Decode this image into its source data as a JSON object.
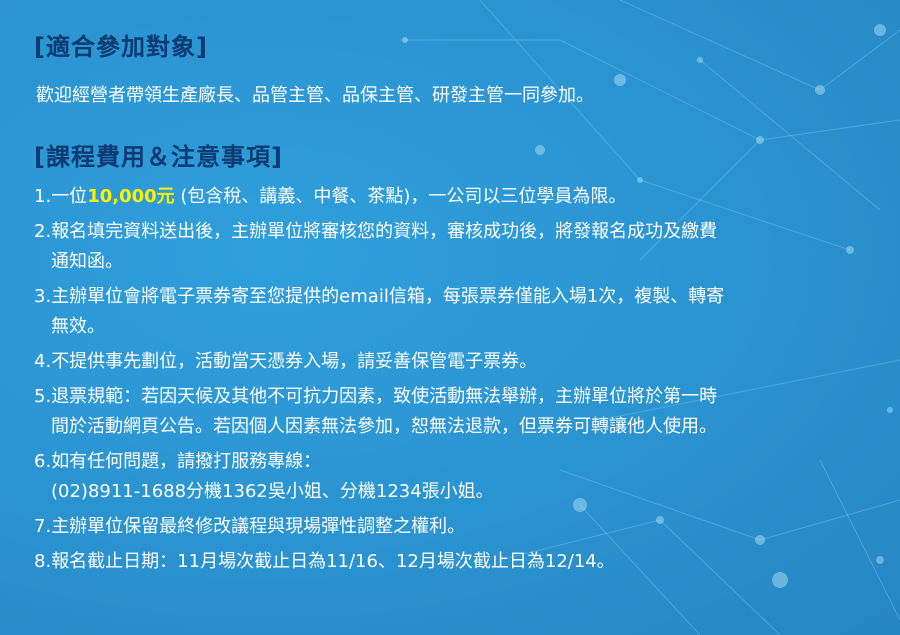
{
  "audience": {
    "heading": "[適合參加對象]",
    "text": "歡迎經營者帶領生產廠長、品管主管、品保主管、研發主管一同參加。"
  },
  "course": {
    "heading": "[課程費用＆注意事項]",
    "items": [
      {
        "num": "1.",
        "pre": "一位",
        "price": "10,000元",
        "post": " (包含稅、講義、中餐、茶點)，一公司以三位學員為限。"
      },
      {
        "num": "2.",
        "line1": "報名填完資料送出後，主辦單位將審核您的資料，審核成功後，將發報名成功及繳費",
        "line2": "通知函。"
      },
      {
        "num": "3.",
        "line1": "主辦單位會將電子票券寄至您提供的email信箱，每張票券僅能入場1次，複製、轉寄",
        "line2": "無效。"
      },
      {
        "num": "4.",
        "line1": "不提供事先劃位，活動當天憑券入場，請妥善保管電子票券。"
      },
      {
        "num": "5.",
        "line1": "退票規範：若因天候及其他不可抗力因素，致使活動無法舉辦，主辦單位將於第一時",
        "line2": "間於活動網頁公告。若因個人因素無法參加，恕無法退款，但票券可轉讓他人使用。"
      },
      {
        "num": "6.",
        "line1": "如有任何問題，請撥打服務專線：",
        "line2": "(02)8911-1688分機1362吳小姐、分機1234張小姐。"
      },
      {
        "num": "7.",
        "line1": "主辦單位保留最終修改議程與現場彈性調整之權利。"
      },
      {
        "num": "8.",
        "line1": "報名截止日期：11月場次截止日為11/16、12月場次截止日為12/14。"
      }
    ]
  },
  "colors": {
    "background": "#2a96d3",
    "heading": "#0d3a72",
    "text": "#ffffff",
    "price": "#fff200"
  }
}
